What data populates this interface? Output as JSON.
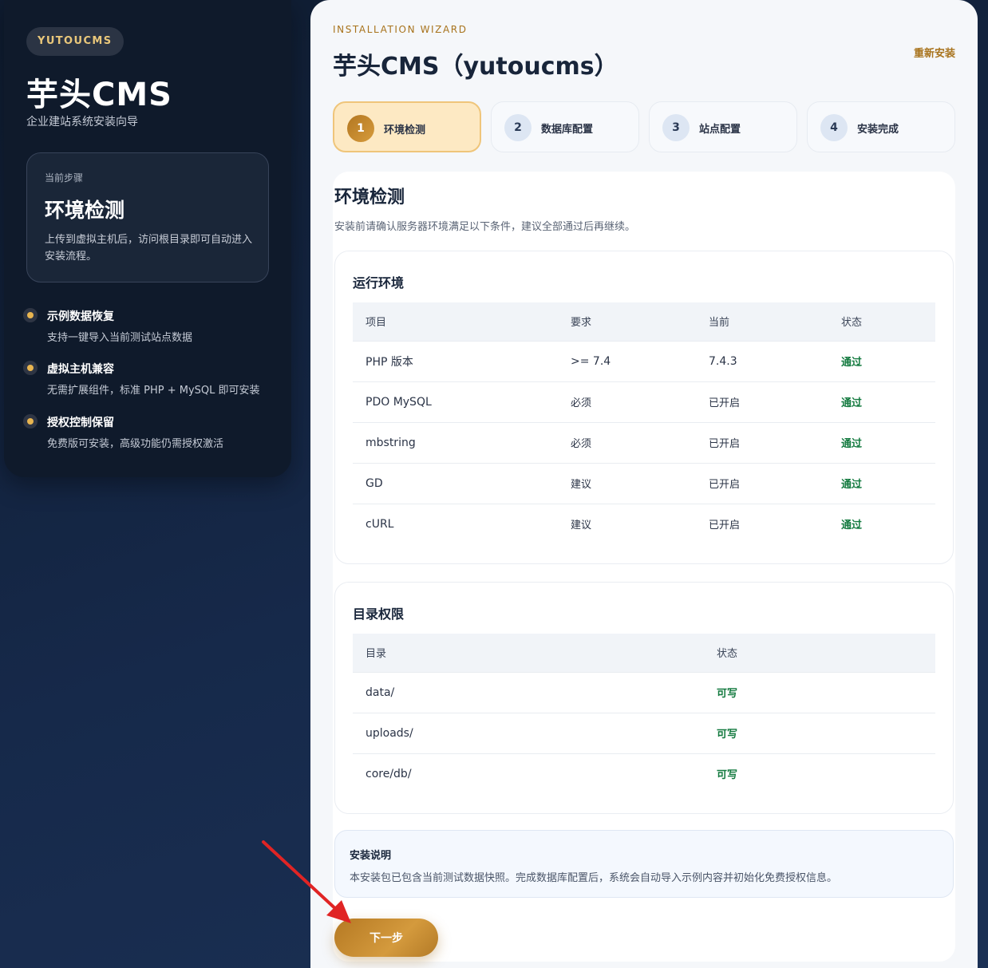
{
  "sidebar": {
    "brand": "YUTOUCMS",
    "title": "芋头CMS",
    "subtitle": "企业建站系统安装向导",
    "current_step_label": "当前步骤",
    "current_step_name": "环境检测",
    "current_step_desc": "上传到虚拟主机后，访问根目录即可自动进入安装流程。",
    "features": [
      {
        "title": "示例数据恢复",
        "desc": "支持一键导入当前测试站点数据"
      },
      {
        "title": "虚拟主机兼容",
        "desc": "无需扩展组件，标准 PHP + MySQL 即可安装"
      },
      {
        "title": "授权控制保留",
        "desc": "免费版可安装，高级功能仍需授权激活"
      }
    ]
  },
  "header": {
    "kicker": "INSTALLATION WIZARD",
    "title": "芋头CMS（yutoucms）",
    "reinstall": "重新安装"
  },
  "steps": [
    {
      "num": "1",
      "name": "环境检测"
    },
    {
      "num": "2",
      "name": "数据库配置"
    },
    {
      "num": "3",
      "name": "站点配置"
    },
    {
      "num": "4",
      "name": "安装完成"
    }
  ],
  "content": {
    "title": "环境检测",
    "desc": "安装前请确认服务器环境满足以下条件，建议全部通过后再继续。"
  },
  "runtime": {
    "title": "运行环境",
    "headers": [
      "项目",
      "要求",
      "当前",
      "状态"
    ],
    "rows": [
      [
        "PHP 版本",
        ">= 7.4",
        "7.4.3",
        "通过"
      ],
      [
        "PDO MySQL",
        "必须",
        "已开启",
        "通过"
      ],
      [
        "mbstring",
        "必须",
        "已开启",
        "通过"
      ],
      [
        "GD",
        "建议",
        "已开启",
        "通过"
      ],
      [
        "cURL",
        "建议",
        "已开启",
        "通过"
      ]
    ]
  },
  "permissions": {
    "title": "目录权限",
    "headers": [
      "目录",
      "状态"
    ],
    "rows": [
      [
        "data/",
        "可写"
      ],
      [
        "uploads/",
        "可写"
      ],
      [
        "core/db/",
        "可写"
      ]
    ]
  },
  "note": {
    "title": "安装说明",
    "text": "本安装包已包含当前测试数据快照。完成数据库配置后，系统会自动导入示例内容并初始化免费授权信息。"
  },
  "next_button": "下一步",
  "colors": {
    "accent": "#a8731c",
    "pass": "#137a3f",
    "sidebar_bg": "#0f1a2b",
    "annotation_arrow": "#e02424"
  }
}
